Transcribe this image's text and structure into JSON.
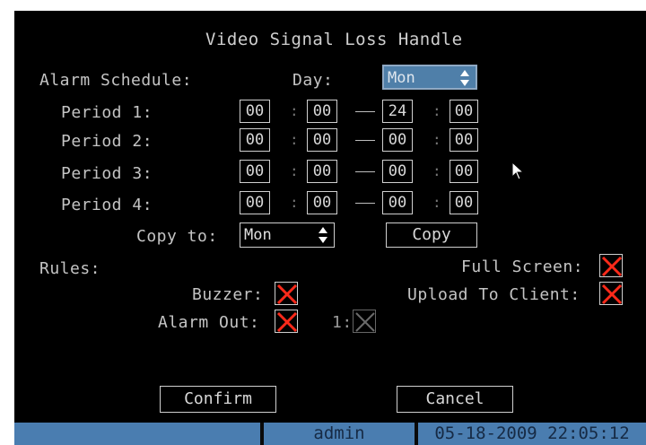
{
  "dialog": {
    "title": "Video Signal Loss Handle"
  },
  "schedule": {
    "label": "Alarm Schedule:",
    "day_label": "Day:",
    "day_value": "Mon",
    "periods": [
      {
        "label": "Period 1:",
        "start_h": "00",
        "start_m": "00",
        "end_h": "24",
        "end_m": "00"
      },
      {
        "label": "Period 2:",
        "start_h": "00",
        "start_m": "00",
        "end_h": "00",
        "end_m": "00"
      },
      {
        "label": "Period 3:",
        "start_h": "00",
        "start_m": "00",
        "end_h": "00",
        "end_m": "00"
      },
      {
        "label": "Period 4:",
        "start_h": "00",
        "start_m": "00",
        "end_h": "00",
        "end_m": "00"
      }
    ],
    "colon": ":",
    "copy_to_label": "Copy to:",
    "copy_to_value": "Mon",
    "copy_button": "Copy"
  },
  "rules": {
    "label": "Rules:",
    "full_screen_label": "Full Screen:",
    "upload_label": "Upload To Client:",
    "buzzer_label": "Buzzer:",
    "alarm_out_label": "Alarm Out:",
    "alarm_out_1_label": "1:",
    "full_screen_checked": true,
    "upload_checked": true,
    "buzzer_checked": true,
    "alarm_out_checked": true,
    "alarm_out_1_checked": false
  },
  "buttons": {
    "confirm": "Confirm",
    "cancel": "Cancel"
  },
  "status": {
    "user": "admin",
    "datetime": "05-18-2009 22:05:12"
  },
  "colors": {
    "screen_bg": "#000000",
    "status_blue": "#4a7db0",
    "check_red": "#ff2a1a",
    "selected_blue": "#4f7fa9"
  }
}
